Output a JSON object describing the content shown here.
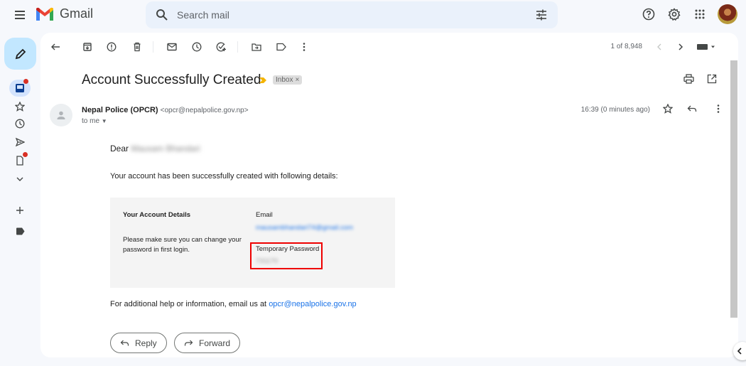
{
  "app": {
    "name": "Gmail",
    "search_placeholder": "Search mail"
  },
  "toolbar": {
    "pager": "1 of 8,948",
    "actions": [
      "back",
      "archive",
      "report-spam",
      "delete",
      "mark-unread",
      "snooze",
      "add-to-tasks",
      "move-to",
      "labels",
      "more"
    ]
  },
  "rail": {
    "items": [
      "inbox",
      "starred",
      "snoozed",
      "sent",
      "drafts",
      "more",
      "create-label",
      "label"
    ]
  },
  "email": {
    "subject": "Account Successfully Created",
    "label": "Inbox",
    "label_remove": "×",
    "sender_name": "Nepal Police (OPCR)",
    "sender_email": "<opcr@nepalpolice.gov.np>",
    "to": "to me",
    "time": "16:39 (0 minutes ago)",
    "greeting": "Dear",
    "recipient_name_redacted": "Mausam Bhandari",
    "intro": "Your account has been successfully created with following details:",
    "details": {
      "heading": "Your Account Details",
      "note": "Please make sure you can change your password in first login.",
      "email_label": "Email",
      "email_value_redacted": "mausambhandari74@gmail.com",
      "password_label": "Temporary Password",
      "password_value_redacted": "731170"
    },
    "help_text": "For additional help or information, email us at",
    "help_link": "opcr@nepalpolice.gov.np"
  },
  "buttons": {
    "reply": "Reply",
    "forward": "Forward"
  },
  "colors": {
    "accent": "#1a73e8",
    "compose_bg": "#c2e7ff",
    "highlight_box": "#ee0000",
    "important_marker": "#f4b400",
    "unread_dot": "#d93025"
  }
}
